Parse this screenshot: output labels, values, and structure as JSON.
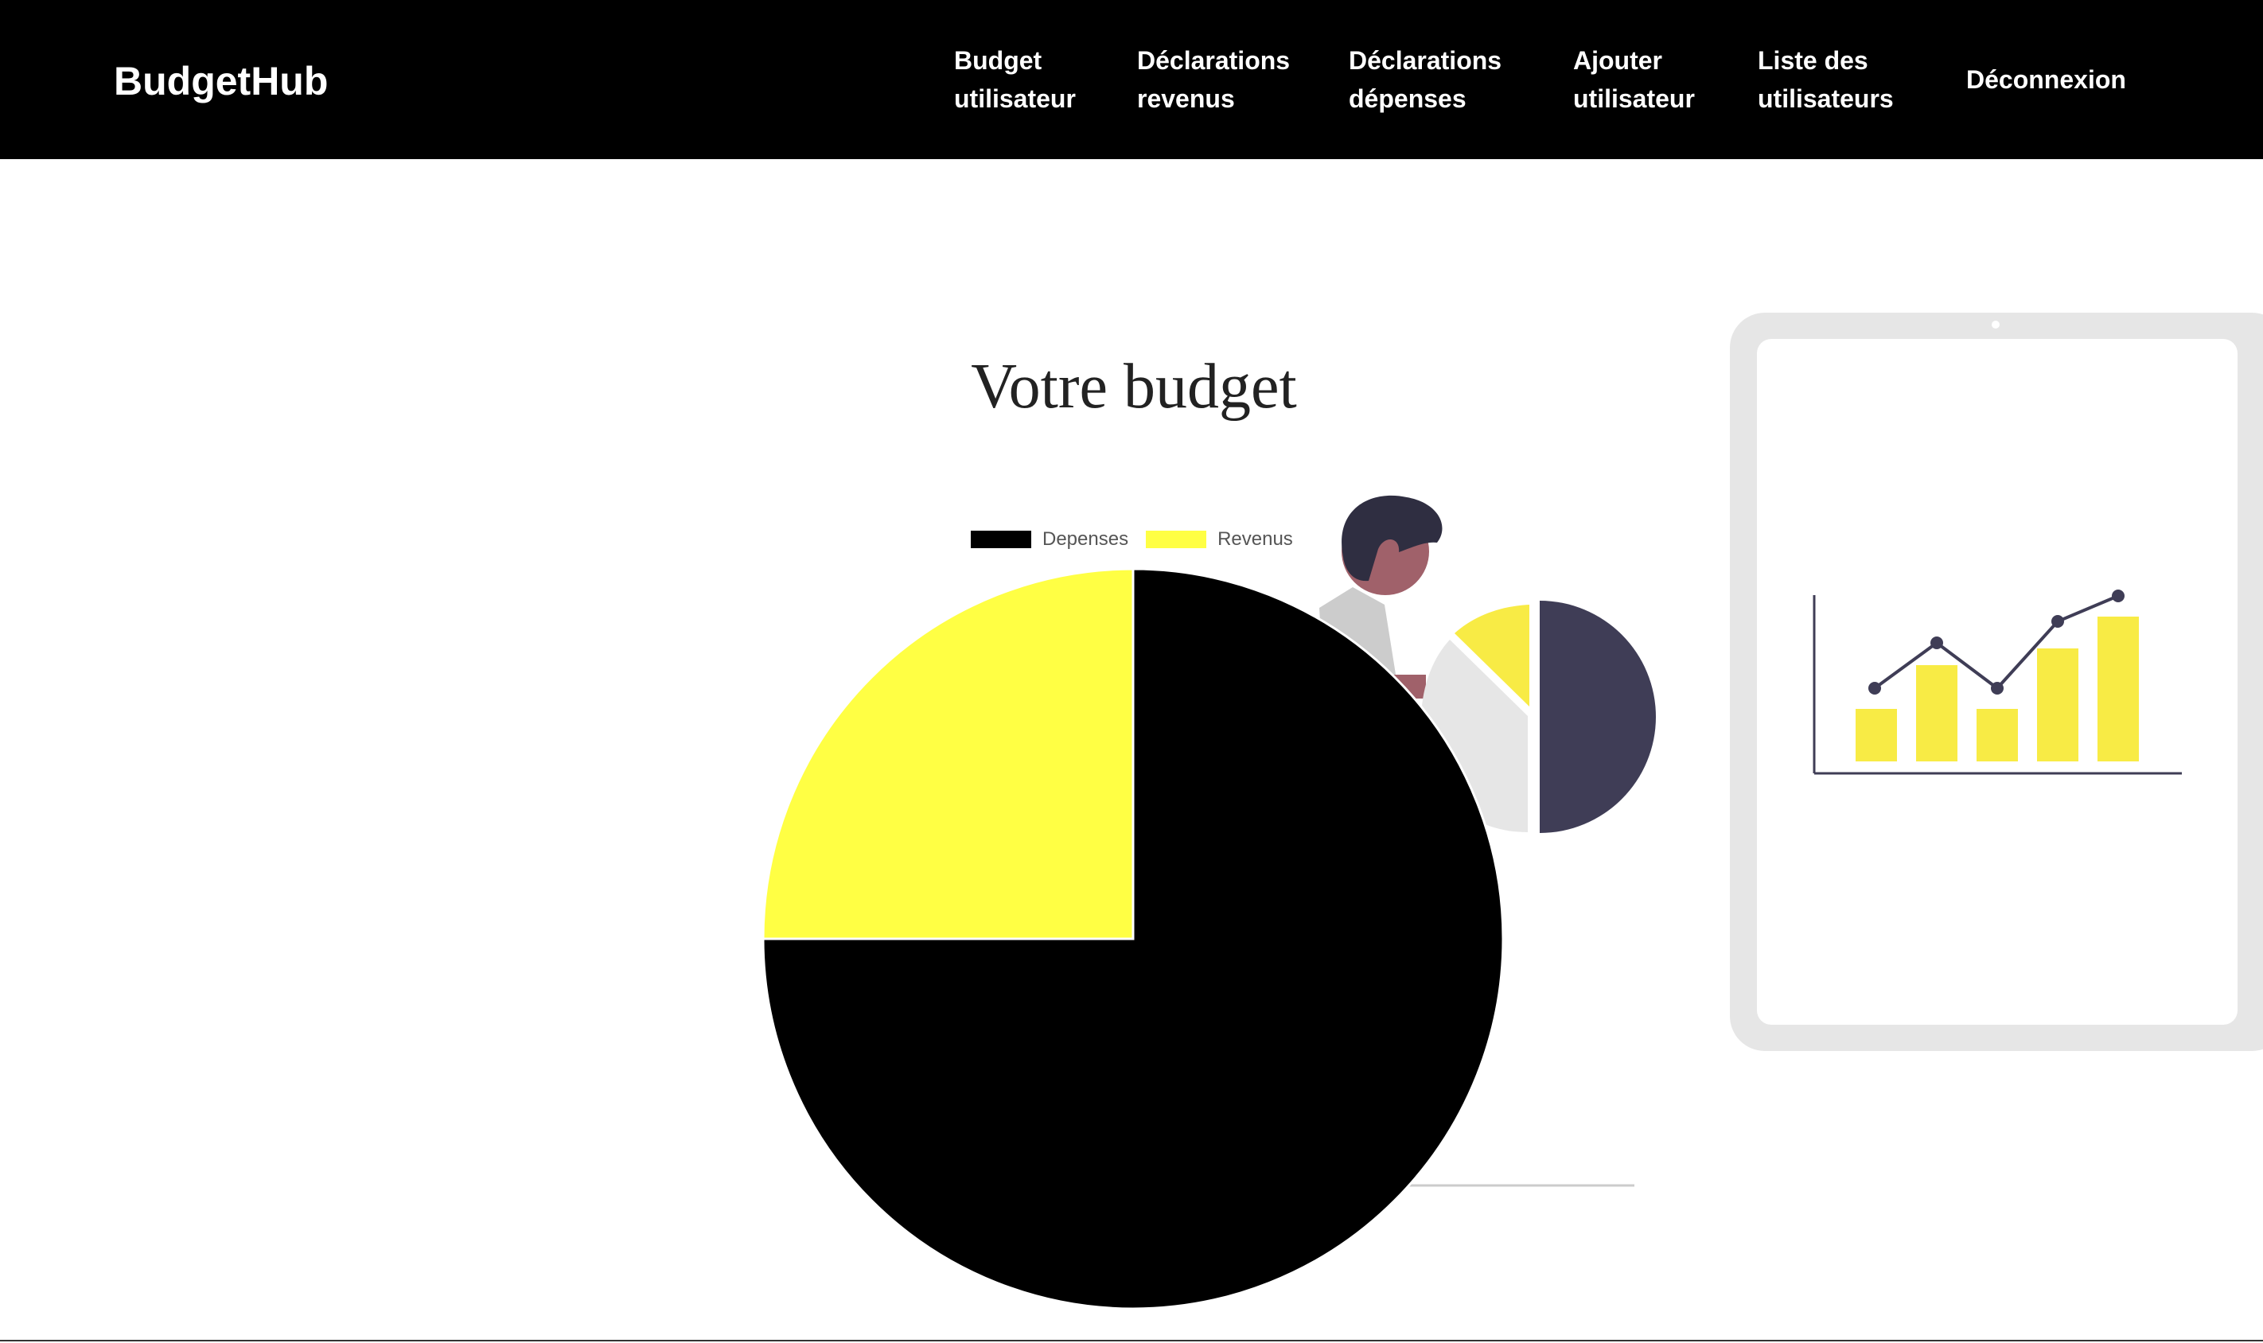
{
  "nav": {
    "brand": "BudgetHub",
    "items": [
      {
        "line1": "Budget",
        "line2": "utilisateur"
      },
      {
        "line1": "Déclarations",
        "line2": "revenus"
      },
      {
        "line1": "Déclarations",
        "line2": "dépenses"
      },
      {
        "line1": "Ajouter",
        "line2": "utilisateur"
      },
      {
        "line1": "Liste des",
        "line2": "utilisateurs"
      },
      {
        "line1": "Déconnexion",
        "line2": ""
      }
    ]
  },
  "main": {
    "title": "Votre budget"
  },
  "colors": {
    "navbar": "#000000",
    "accent_yellow": "#ffff44",
    "dark_slice": "#000000",
    "illustration_yellow": "#f8eb45",
    "illustration_dark": "#3f3d56",
    "tablet_gray": "#e6e6e6"
  },
  "chart_data": {
    "type": "pie",
    "title": "",
    "labels": [
      "Depenses",
      "Revenus"
    ],
    "values": [
      75,
      25
    ],
    "colors": [
      "#000000",
      "#ffff44"
    ],
    "legend_position": "top"
  },
  "illustration_icons": [
    "person-icon",
    "pie-chart-icon",
    "tablet-bar-chart-icon"
  ]
}
